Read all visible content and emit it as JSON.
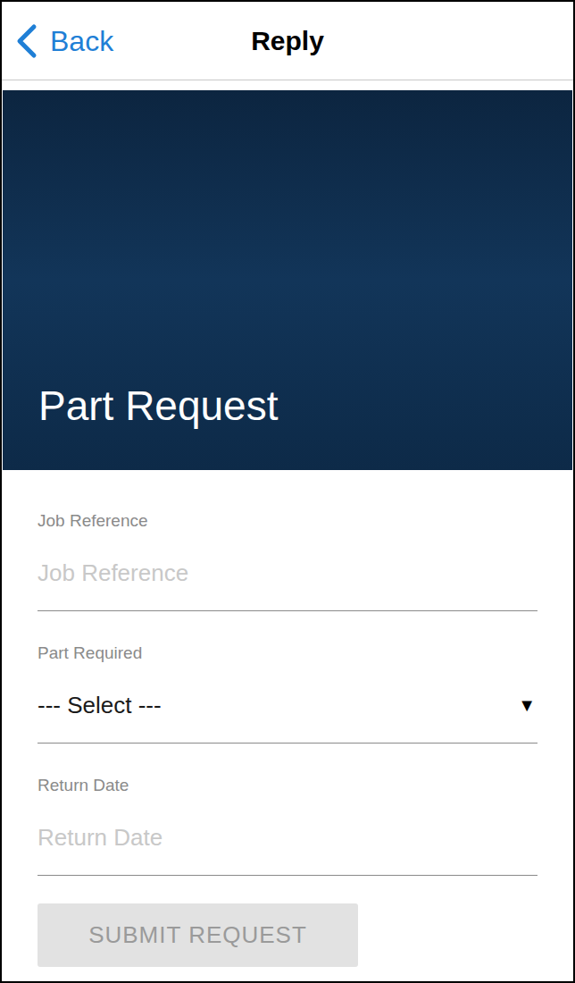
{
  "nav": {
    "back": "Back",
    "title": "Reply"
  },
  "hero": {
    "title": "Part Request"
  },
  "fields": [
    {
      "kind": "text",
      "label": "Job Reference",
      "placeholder": "Job Reference"
    },
    {
      "kind": "select",
      "label": "Part Required",
      "value": "--- Select ---",
      "arrow": "▼"
    },
    {
      "kind": "text",
      "label": "Return Date",
      "placeholder": "Return Date"
    }
  ],
  "submit": {
    "label": "SUBMIT REQUEST",
    "disabled": true
  }
}
